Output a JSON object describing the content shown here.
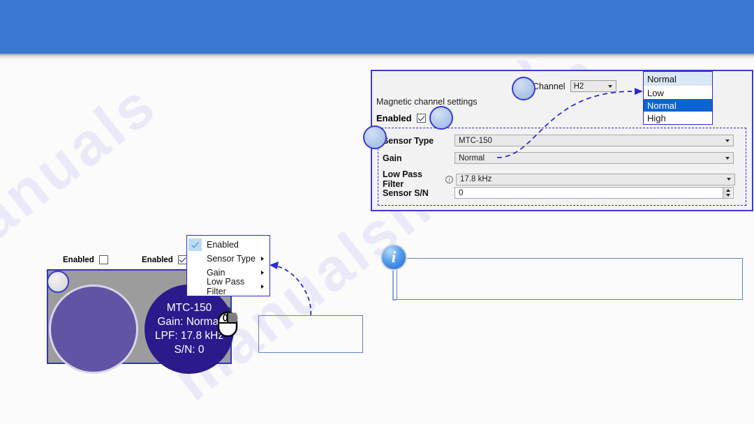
{
  "banner": {
    "color": "#3a76d4"
  },
  "watermark": {
    "line_a": "manualslib. com",
    "line_b": "manualslib",
    "line_c": "manuals"
  },
  "settings_panel": {
    "group_label": "Magnetic channel settings",
    "enabled_label": "Enabled",
    "enabled_checked": true,
    "channel_label": "Channel",
    "channel_value": "H2",
    "fields": [
      {
        "label": "Sensor Type",
        "value": "MTC-150",
        "control": "combo",
        "info": false
      },
      {
        "label": "Gain",
        "value": "Normal",
        "control": "combo",
        "info": false
      },
      {
        "label": "Low Pass Filter",
        "value": "17.8 kHz",
        "control": "combo",
        "info": true
      },
      {
        "label": "Sensor S/N",
        "value": "0",
        "control": "spinner",
        "info": false
      }
    ]
  },
  "gain_dropdown": {
    "selected_display": "Normal",
    "items": [
      {
        "label": "Low",
        "selected": false
      },
      {
        "label": "Normal",
        "selected": true
      },
      {
        "label": "High",
        "selected": false
      }
    ]
  },
  "device_area": {
    "enabled_left": {
      "label": "Enabled",
      "checked": false
    },
    "enabled_right": {
      "label": "Enabled",
      "checked": true
    },
    "panel_color": "#9c9c9c",
    "sensor_left": {
      "color": "#6254a4",
      "lines": []
    },
    "sensor_right": {
      "color": "#2a1a8c",
      "lines": [
        "MTC-150",
        "Gain: Normal",
        "LPF: 17.8 kHz",
        "S/N: 0"
      ]
    }
  },
  "context_menu": {
    "items": [
      {
        "label": "Enabled",
        "checked": true,
        "submenu": false
      },
      {
        "label": "Sensor Type",
        "checked": false,
        "submenu": true
      },
      {
        "label": "Gain",
        "checked": false,
        "submenu": true
      },
      {
        "label": "Low Pass Filter",
        "checked": false,
        "submenu": true
      }
    ]
  },
  "icons": {
    "mouse": "mouse-right-click-icon",
    "info_big": "i",
    "info_mini": "i"
  },
  "callouts": {
    "note_small_text": "",
    "note_info_text": ""
  },
  "colors": {
    "accent_blue": "#2a2ad6",
    "highlight_blue": "#0a64d2",
    "panel_gray": "#f2f2f2"
  }
}
